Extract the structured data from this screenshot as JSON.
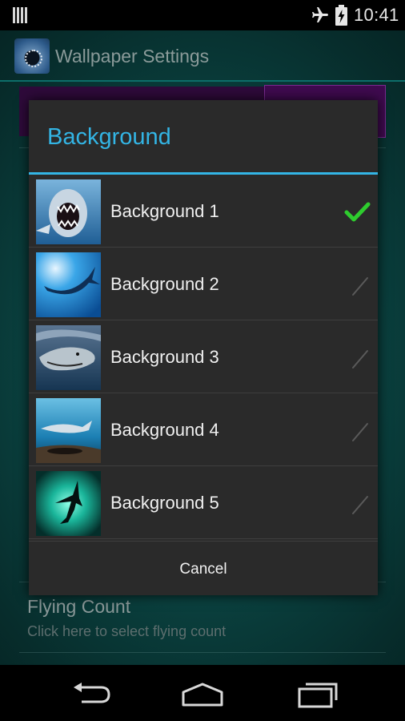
{
  "status_bar": {
    "time": "10:41",
    "icons": [
      "signal-icon",
      "airplane-icon",
      "battery-charging-icon"
    ]
  },
  "app": {
    "title": "Wallpaper Settings",
    "icon": "shark-app-icon"
  },
  "settings": {
    "flying_count": {
      "title": "Flying Count",
      "subtitle": "Click here to select flying count"
    }
  },
  "dialog": {
    "title": "Background",
    "items": [
      {
        "label": "Background 1",
        "checked": true
      },
      {
        "label": "Background 2",
        "checked": false
      },
      {
        "label": "Background 3",
        "checked": false
      },
      {
        "label": "Background 4",
        "checked": false
      },
      {
        "label": "Background 5",
        "checked": false
      }
    ],
    "cancel_label": "Cancel"
  },
  "colors": {
    "accent": "#33b5e5",
    "check": "#2ecc2e",
    "dialog_bg": "#2a2a2a"
  },
  "nav_bar": {
    "icons": [
      "back-icon",
      "home-icon",
      "recents-icon"
    ]
  }
}
